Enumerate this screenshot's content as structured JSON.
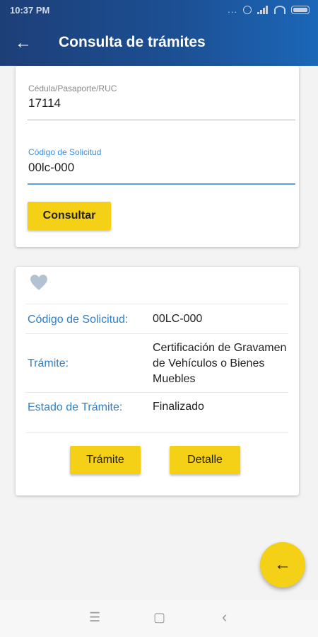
{
  "status_bar": {
    "time": "10:37 PM",
    "dots": "..."
  },
  "app_bar": {
    "back_icon": "←",
    "title": "Consulta de trámites"
  },
  "form": {
    "id_label": "Cédula/Pasaporte/RUC",
    "id_value": "17114",
    "code_label": "Código de Solicitud",
    "code_value": "00lc-000",
    "submit_label": "Consultar"
  },
  "result": {
    "favorite_icon": "heart-icon",
    "rows": [
      {
        "label": "Código de Solicitud:",
        "value": "00LC-000"
      },
      {
        "label": "Trámite:",
        "value": "Certificación de Gravamen de Vehículos o Bienes Muebles"
      },
      {
        "label": "Estado de Trámite:",
        "value": "Finalizado"
      }
    ],
    "buttons": {
      "tramite": "Trámite",
      "detalle": "Detalle"
    }
  },
  "fab_icon": "←",
  "nav": {
    "menu": "☰",
    "home": "▢",
    "back": "‹"
  },
  "colors": {
    "accent": "#f4d016",
    "primary": "#1c4f93",
    "label_blue": "#2f80c8"
  }
}
